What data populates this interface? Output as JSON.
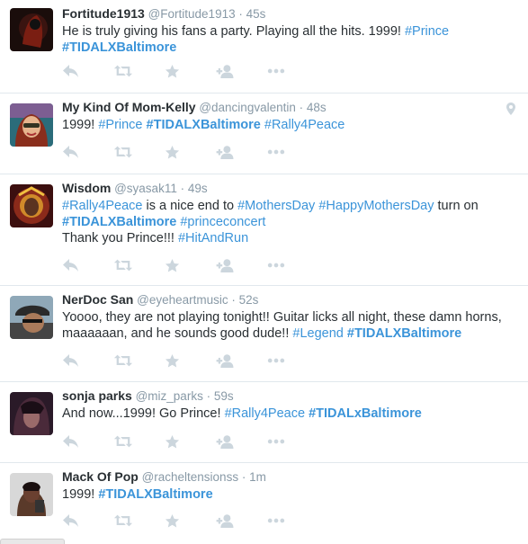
{
  "colors": {
    "link": "#3b94d9",
    "meta": "#8899a6",
    "text": "#292f33",
    "icon": "#ccd6dd"
  },
  "tweets": [
    {
      "fullname": "Fortitude1913",
      "username": "@Fortitude1913",
      "time": "45s",
      "line1_plain": "He is truly giving his fans a party. Playing all the hits. 1999! ",
      "line1_tag": "#Prince",
      "line2_tag": "#TIDALXBaltimore"
    },
    {
      "fullname": "My Kind Of Mom-Kelly",
      "username": "@dancingvalentin",
      "time": "48s",
      "plain": "1999! ",
      "tag1": "#Prince",
      "tag2": "#TIDALXBaltimore",
      "tag3": "#Rally4Peace"
    },
    {
      "fullname": "Wisdom",
      "username": "@syasak11",
      "time": "49s",
      "tag1": "#Rally4Peace",
      "plain1": " is a nice end to ",
      "tag2": "#MothersDay",
      "tag3": "#HappyMothersDay",
      "plain2": " turn on",
      "tag4": "#TIDALXBaltimore",
      "tag5": "#princeconcert",
      "plain3": "Thank you Prince!!! ",
      "tag6": "#HitAndRun"
    },
    {
      "fullname": "NerDoc San",
      "username": "@eyeheartmusic",
      "time": "52s",
      "line1": "Yoooo, they are not playing tonight!! Guitar licks all night, these damn horns,",
      "line2_plain": "maaaaaan, and he sounds good dude!! ",
      "tag1": "#Legend",
      "tag2": "#TIDALXBaltimore"
    },
    {
      "fullname": "sonja parks",
      "username": "@miz_parks",
      "time": "59s",
      "plain": "And now...1999!  Go Prince! ",
      "tag1": "#Rally4Peace",
      "tag2": "#TIDALxBaltimore"
    },
    {
      "fullname": "Mack Of Pop",
      "username": "@racheltensionss",
      "time": "1m",
      "plain": "1999! ",
      "tag1": "#TIDALXBaltimore"
    }
  ],
  "actions": {
    "reply": "reply-icon",
    "retweet": "retweet-icon",
    "favorite": "star-icon",
    "follow": "follow-icon",
    "more": "more-icon"
  },
  "separator": "·"
}
